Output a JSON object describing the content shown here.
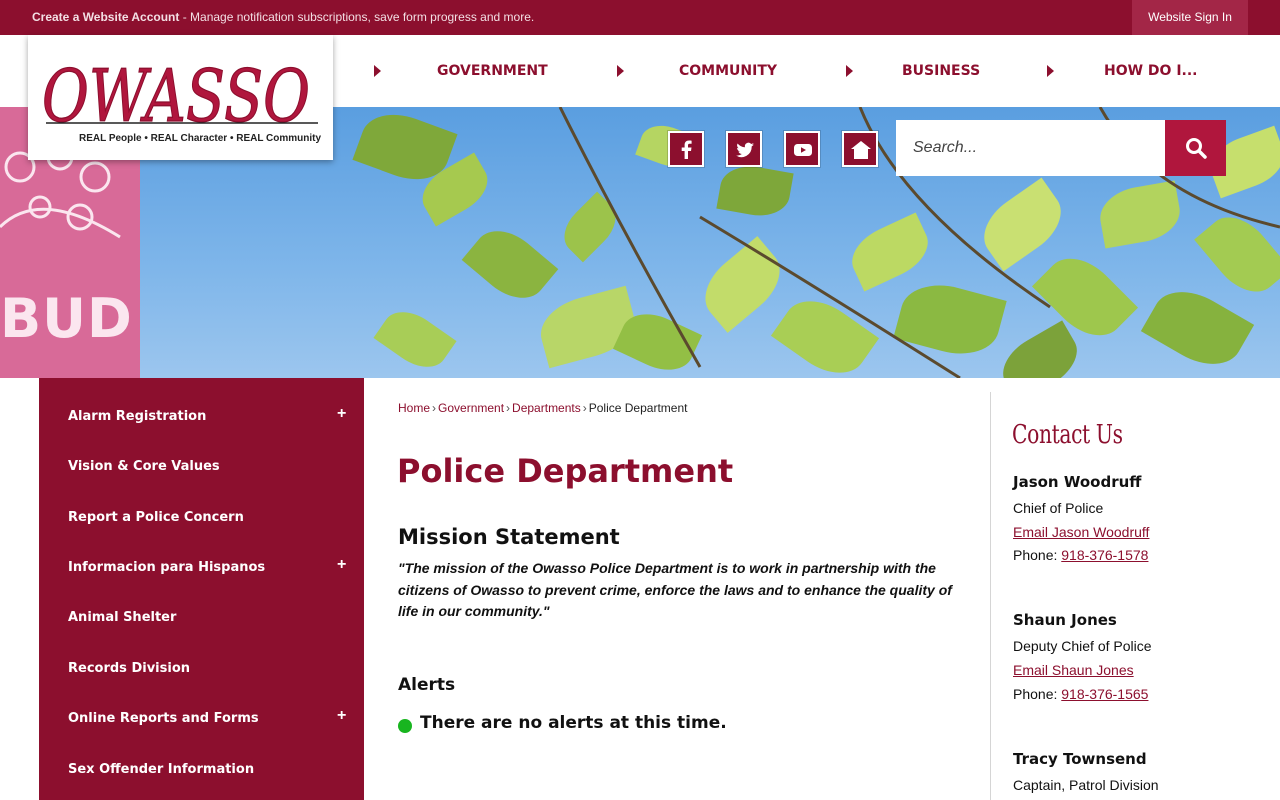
{
  "topbar": {
    "account_label": "Create a Website Account",
    "account_desc": " - Manage notification subscriptions, save form progress and more.",
    "signin_label": "Website Sign In"
  },
  "logo": {
    "wordmark": "OWASSO",
    "tagline": "REAL People • REAL Character • REAL Community"
  },
  "nav": {
    "items": [
      {
        "label": "GOVERNMENT"
      },
      {
        "label": "COMMUNITY"
      },
      {
        "label": "BUSINESS"
      },
      {
        "label": "HOW DO I..."
      }
    ]
  },
  "banner": {
    "sign_text": "BUD"
  },
  "social": [
    "facebook-icon",
    "twitter-icon",
    "youtube-icon",
    "home-icon"
  ],
  "search": {
    "placeholder": "Search..."
  },
  "sidebar": {
    "items": [
      {
        "label": "Alarm Registration",
        "expandable": true
      },
      {
        "label": "Vision & Core Values",
        "expandable": false
      },
      {
        "label": "Report a Police Concern",
        "expandable": false
      },
      {
        "label": "Informacion para Hispanos",
        "expandable": true
      },
      {
        "label": "Animal Shelter",
        "expandable": false
      },
      {
        "label": "Records Division",
        "expandable": false
      },
      {
        "label": "Online Reports and Forms",
        "expandable": true
      },
      {
        "label": "Sex Offender Information",
        "expandable": false
      }
    ],
    "expand_symbol": "+"
  },
  "breadcrumb": {
    "items": [
      "Home",
      "Government",
      "Departments"
    ],
    "current": "Police Department",
    "separator": "›"
  },
  "main": {
    "title": "Police Department",
    "mission_heading": "Mission Statement",
    "mission_text": "\"The mission of the Owasso Police Department is to work in partnership with the citizens of Owasso to prevent crime, enforce the laws and to enhance the quality of life in our community.\"",
    "alerts_heading": "Alerts",
    "alerts_text": "There are no alerts at this time."
  },
  "contact": {
    "title": "Contact Us",
    "phone_prefix": "Phone: ",
    "people": [
      {
        "name": "Jason Woodruff",
        "role": "Chief of Police",
        "email_label": "Email Jason Woodruff",
        "phone": "918-376-1578"
      },
      {
        "name": "Shaun Jones",
        "role": "Deputy Chief of Police",
        "email_label": "Email Shaun Jones",
        "phone": "918-376-1565"
      },
      {
        "name": "Tracy Townsend",
        "role": "Captain, Patrol Division"
      }
    ]
  },
  "colors": {
    "brand": "#8c0f2e",
    "search_button": "#b0163d",
    "alert_ok": "#18b51f"
  }
}
